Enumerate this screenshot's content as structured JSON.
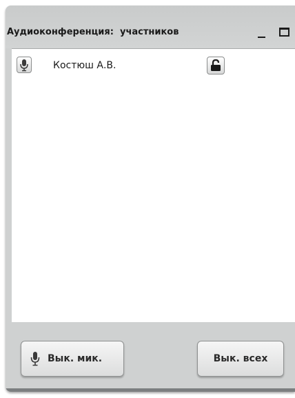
{
  "window": {
    "title": "Аудиоконференция:  участников",
    "minimize_icon": "minimize-icon",
    "maximize_icon": "maximize-icon"
  },
  "participants": [
    {
      "name": "Костюш А.В.",
      "mic_icon": "microphone-icon",
      "lock_icon": "unlocked-padlock-icon"
    }
  ],
  "footer": {
    "mute_mic_label": "Вык. мик.",
    "mute_mic_icon": "microphone-icon",
    "mute_all_label": "Вык. всех"
  }
}
